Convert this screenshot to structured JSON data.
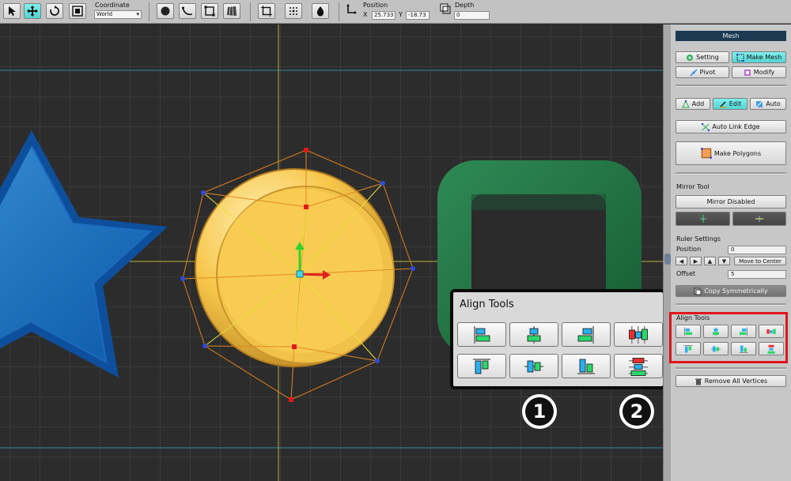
{
  "toolbar": {
    "coordinate_label": "Coordinate",
    "coordinate_value": "World",
    "position_label": "Position",
    "x_label": "X",
    "x_value": "25.733",
    "y_label": "Y",
    "y_value": "-18.73",
    "depth_label": "Depth",
    "depth_value": "0"
  },
  "panel": {
    "title": "Mesh",
    "setting": "Setting",
    "make_mesh": "Make Mesh",
    "pivot": "Pivot",
    "modify": "Modify",
    "add": "Add",
    "edit": "Edit",
    "auto": "Auto",
    "auto_link_edge": "Auto Link Edge",
    "make_polygons": "Make Polygons",
    "mirror_tool_label": "Mirror Tool",
    "mirror_disabled": "Mirror Disabled",
    "ruler_settings_label": "Ruler Settings",
    "position_label": "Position",
    "position_value": "0",
    "move_to_center": "Move to Center",
    "offset_label": "Offset",
    "offset_value": "5",
    "copy_symmetrically": "Copy Symmetrically",
    "align_tools_label": "Align Tools",
    "remove_all_vertices": "Remove All Vertices"
  },
  "callout": {
    "title": "Align Tools",
    "marker_1": "1",
    "marker_2": "2"
  },
  "colors": {
    "accent_cyan": "#54d6d3",
    "highlight_red": "#e0141c",
    "panel_title_bg": "#1b3a52"
  }
}
